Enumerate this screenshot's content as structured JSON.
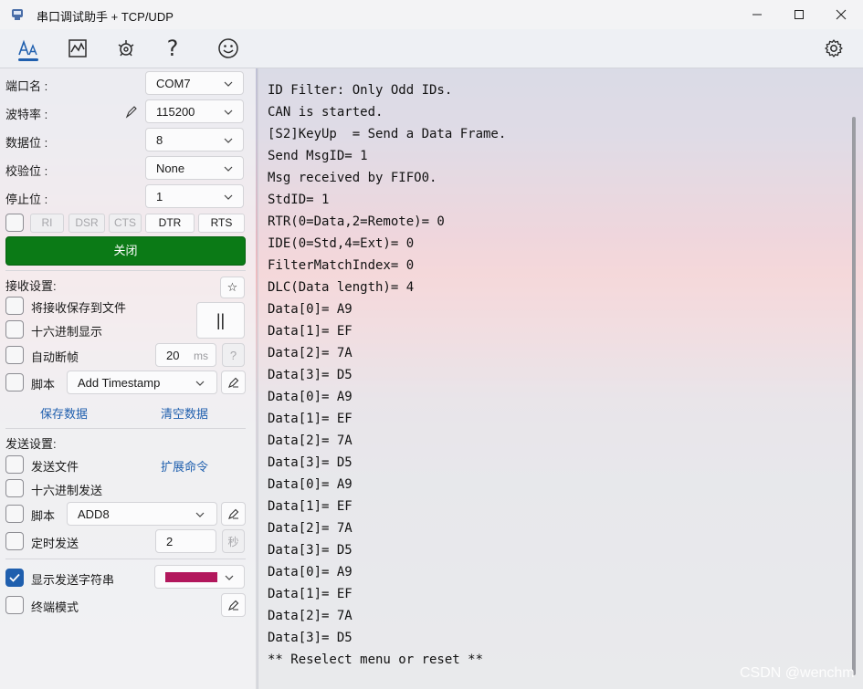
{
  "window": {
    "title": "串口调试助手 + TCP/UDP",
    "icons": [
      "app-icon",
      "minimize-icon",
      "maximize-icon",
      "close-icon"
    ]
  },
  "toolbar": {
    "icons": [
      "font-icon",
      "chart-icon",
      "network-icon",
      "help-icon",
      "smiley-icon",
      "settings-icon"
    ],
    "help_glyph": "?"
  },
  "serial": {
    "port_label": "端口名 :",
    "port_value": "COM7",
    "baud_label": "波特率 :",
    "baud_value": "115200",
    "databits_label": "数据位 :",
    "databits_value": "8",
    "parity_label": "校验位 :",
    "parity_value": "None",
    "stopbits_label": "停止位 :",
    "stopbits_value": "1",
    "pins": [
      "RI",
      "DSR",
      "CTS",
      "DTR",
      "RTS"
    ],
    "close_label": "关闭"
  },
  "receive": {
    "header": "接收设置:",
    "star_glyph": "☆",
    "save_to_file": "将接收保存到文件",
    "hex_display": "十六进制显示",
    "pause_glyph": "||",
    "auto_break": "自动断帧",
    "auto_break_value": "20",
    "auto_break_unit": "ms",
    "help_glyph": "?",
    "script_label": "脚本",
    "script_value": "Add Timestamp",
    "save_data": "保存数据",
    "clear_data": "清空数据"
  },
  "send": {
    "header": "发送设置:",
    "send_file": "发送文件",
    "ext_cmd": "扩展命令",
    "hex_send": "十六进制发送",
    "script_label": "脚本",
    "script_value": "ADD8",
    "timed_send": "定时发送",
    "timed_value": "2",
    "timed_unit": "秒",
    "show_send_string": "显示发送字符串",
    "show_send_checked": true,
    "send_color": "#b2175c",
    "terminal_mode": "终端模式"
  },
  "terminal": {
    "lines": [
      "ID Filter: Only Odd IDs.",
      "CAN is started.",
      "[S2]KeyUp  = Send a Data Frame.",
      "Send MsgID= 1",
      "Msg received by FIFO0.",
      "StdID= 1",
      "RTR(0=Data,2=Remote)= 0",
      "IDE(0=Std,4=Ext)= 0",
      "FilterMatchIndex= 0",
      "DLC(Data length)= 4",
      "Data[0]= A9",
      "Data[1]= EF",
      "Data[2]= 7A",
      "Data[3]= D5",
      "Data[0]= A9",
      "Data[1]= EF",
      "Data[2]= 7A",
      "Data[3]= D5",
      "Data[0]= A9",
      "Data[1]= EF",
      "Data[2]= 7A",
      "Data[3]= D5",
      "Data[0]= A9",
      "Data[1]= EF",
      "Data[2]= 7A",
      "Data[3]= D5",
      "** Reselect menu or reset **"
    ]
  },
  "watermark": "CSDN @wenchm",
  "colors": {
    "accent": "#1f5fae",
    "close_button": "#0b7a16"
  }
}
